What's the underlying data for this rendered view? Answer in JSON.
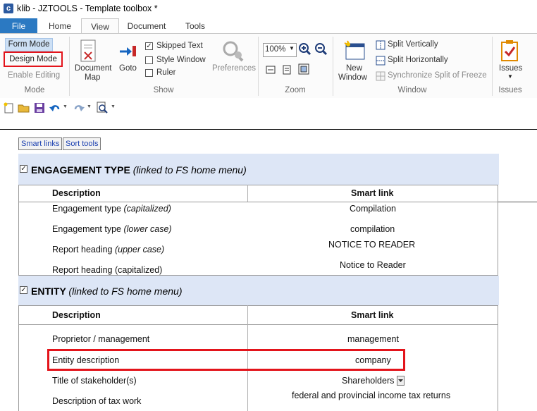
{
  "title": {
    "icon": "c",
    "text": "klib - JZTOOLS - Template toolbox *"
  },
  "tabs": [
    "File",
    "Home",
    "View",
    "Document",
    "Tools"
  ],
  "ribbon": {
    "mode": {
      "form_mode": "Form Mode",
      "design_mode": "Design Mode",
      "enable_editing": "Enable Editing",
      "label": "Mode"
    },
    "show": {
      "document_map_1": "Document",
      "document_map_2": "Map",
      "goto": "Goto",
      "skipped_text": "Skipped Text",
      "style_window": "Style Window",
      "ruler": "Ruler",
      "preferences": "Preferences",
      "label": "Show"
    },
    "zoom": {
      "value": "100%",
      "label": "Zoom"
    },
    "window": {
      "new_window_1": "New",
      "new_window_2": "Window",
      "split_vertically": "Split Vertically",
      "split_horizontally": "Split Horizontally",
      "synchronize": "Synchronize Split of Freeze",
      "label": "Window"
    },
    "issues": {
      "button": "Issues",
      "label": "Issues"
    }
  },
  "document": {
    "buttons": {
      "smart_links": "Smart links",
      "sort_tools": "Sort tools"
    },
    "engagement": {
      "title": "ENGAGEMENT TYPE",
      "subtitle": "(linked to FS home menu)",
      "col_desc": "Description",
      "col_link": "Smart link",
      "rows": [
        {
          "desc": "Engagement type",
          "desc_note": "(capitalized)",
          "link": "Compilation"
        },
        {
          "desc": "Engagement type",
          "desc_note": "(lower case)",
          "link": "compilation"
        },
        {
          "desc": "Report heading",
          "desc_note": "(upper case)",
          "link": "NOTICE TO READER"
        },
        {
          "desc": "Report heading (capitalized)",
          "desc_note": "",
          "link": "Notice to Reader"
        }
      ]
    },
    "entity": {
      "title": "ENTITY",
      "subtitle": "(linked to FS home menu)",
      "col_desc": "Description",
      "col_link": "Smart link",
      "rows": [
        {
          "desc": "Proprietor / management",
          "link": "management"
        },
        {
          "desc": "Entity description",
          "link": "company"
        },
        {
          "desc": "Title of stakeholder(s)",
          "link": "Shareholders"
        },
        {
          "desc": "Description of tax work",
          "link": "federal and provincial income tax returns"
        }
      ]
    }
  },
  "colors": {
    "accent": "#2b79c2",
    "highlight": "#e3141b",
    "panel": "#dde6f6"
  }
}
